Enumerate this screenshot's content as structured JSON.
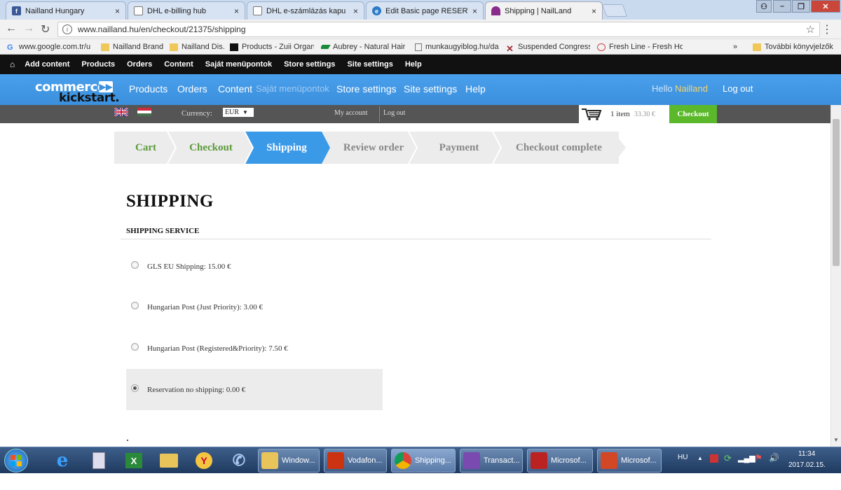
{
  "browser": {
    "tabs": [
      {
        "title": "Nailland Hungary",
        "icon": "facebook-icon"
      },
      {
        "title": "DHL e-billing hub",
        "icon": "page-icon"
      },
      {
        "title": "DHL e-számlázás kapu",
        "icon": "page-icon"
      },
      {
        "title": "Edit Basic page RESERVA",
        "icon": "drupal-icon"
      },
      {
        "title": "Shipping | NailLand",
        "icon": "nailland-icon"
      }
    ],
    "tab_close": "×",
    "url": "www.nailland.hu/en/checkout/21375/shipping",
    "bookmarks": [
      {
        "label": "www.google.com.tr/u",
        "icon": "google-icon"
      },
      {
        "label": "Nailland Brand",
        "icon": "folder-icon"
      },
      {
        "label": "Nailland Dis.",
        "icon": "folder-icon"
      },
      {
        "label": "Products - Zuii Organ",
        "icon": "zuii-icon"
      },
      {
        "label": "Aubrey - Natural Hair",
        "icon": "aubrey-icon"
      },
      {
        "label": "munkaugyiblog.hu/da",
        "icon": "page-icon"
      },
      {
        "label": "Suspended Congress",
        "icon": "x-icon"
      },
      {
        "label": "Fresh Line - Fresh Ho",
        "icon": "freshline-icon"
      }
    ],
    "bookmarks_more": "»",
    "other_bookmarks": "További könyvjelzők"
  },
  "admin_toolbar": {
    "items": [
      "Add content",
      "Products",
      "Orders",
      "Content",
      "Saját menüpontok",
      "Store settings",
      "Site settings",
      "Help"
    ]
  },
  "blue_bar": {
    "logo_top": "commerce",
    "logo_bottom": "kickstart.",
    "nav": [
      "Products",
      "Orders",
      "Content",
      "Saját menüpontok",
      "Store settings",
      "Site settings",
      "Help"
    ],
    "hello_prefix": "Hello",
    "user_name": "Nailland",
    "logout": "Log out"
  },
  "store_bar": {
    "currency_label": "Currency:",
    "currency_value": "EUR",
    "my_account": "My account",
    "logout": "Log out",
    "cart_count": "1 item",
    "cart_total": "33.30 €",
    "checkout_button": "Checkout"
  },
  "steps": [
    {
      "label": "Cart",
      "state": "done"
    },
    {
      "label": "Checkout",
      "state": "done"
    },
    {
      "label": "Shipping",
      "state": "active"
    },
    {
      "label": "Review order",
      "state": "todo"
    },
    {
      "label": "Payment",
      "state": "todo"
    },
    {
      "label": "Checkout complete",
      "state": "todo"
    }
  ],
  "page": {
    "title": "SHIPPING",
    "section_title": "SHIPPING SERVICE",
    "options": [
      {
        "label": "GLS EU Shipping: 15.00 €",
        "checked": false
      },
      {
        "label": "Hungarian Post (Just Priority): 3.00 €",
        "checked": false
      },
      {
        "label": "Hungarian Post (Registered&Priority): 7.50 €",
        "checked": false
      },
      {
        "label": "Reservation no shipping: 0.00 €",
        "checked": true
      }
    ]
  },
  "taskbar": {
    "buttons": [
      {
        "label": "Window...",
        "icon": "folder-icon"
      },
      {
        "label": "Vodafon...",
        "icon": "vodafone-icon"
      },
      {
        "label": "Shipping...",
        "icon": "chrome-icon"
      },
      {
        "label": "Transact...",
        "icon": "app-icon"
      },
      {
        "label": "Microsof...",
        "icon": "outlook-icon"
      },
      {
        "label": "Microsof...",
        "icon": "powerpoint-icon"
      }
    ],
    "language": "HU",
    "time": "11:34",
    "date": "2017.02.15."
  },
  "colors": {
    "admin_bar": "#111111",
    "blue_bar": "#3b8fdc",
    "step_done_text": "#5a9a3a",
    "step_active_bg": "#3b9ae8",
    "step_todo_text": "#888888",
    "checkout_green": "#5ab82a"
  }
}
